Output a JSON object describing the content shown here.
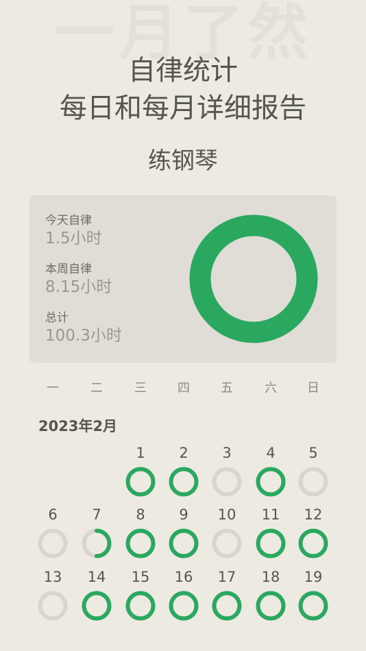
{
  "watermark": "一月了然",
  "header": {
    "title": "自律统计",
    "subtitle": "每日和每月详细报告"
  },
  "habit": {
    "name": "练钢琴"
  },
  "summary": {
    "today_label": "今天自律",
    "today_value": "1.5小时",
    "week_label": "本周自律",
    "week_value": "8.15小时",
    "total_label": "总计",
    "total_value": "100.3小时",
    "ring_progress": 1.0
  },
  "weekdays": [
    "一",
    "二",
    "三",
    "四",
    "五",
    "六",
    "日"
  ],
  "month_label": "2023年2月",
  "colors": {
    "accent": "#2aa860",
    "ring_empty": "#d8d5cf",
    "background": "#edeae2",
    "card": "#e0ddd6"
  },
  "calendar": {
    "first_weekday": 2,
    "days": [
      {
        "day": "1",
        "progress": 1.0
      },
      {
        "day": "2",
        "progress": 1.0
      },
      {
        "day": "3",
        "progress": 0
      },
      {
        "day": "4",
        "progress": 1.0
      },
      {
        "day": "5",
        "progress": 0
      },
      {
        "day": "6",
        "progress": 0
      },
      {
        "day": "7",
        "progress": 0.5
      },
      {
        "day": "8",
        "progress": 1.0
      },
      {
        "day": "9",
        "progress": 1.0
      },
      {
        "day": "10",
        "progress": 0
      },
      {
        "day": "11",
        "progress": 1.0
      },
      {
        "day": "12",
        "progress": 1.0
      },
      {
        "day": "13",
        "progress": 0
      },
      {
        "day": "14",
        "progress": 1.0
      },
      {
        "day": "15",
        "progress": 1.0
      },
      {
        "day": "16",
        "progress": 1.0
      },
      {
        "day": "17",
        "progress": 1.0
      },
      {
        "day": "18",
        "progress": 1.0
      },
      {
        "day": "19",
        "progress": 1.0
      }
    ]
  }
}
